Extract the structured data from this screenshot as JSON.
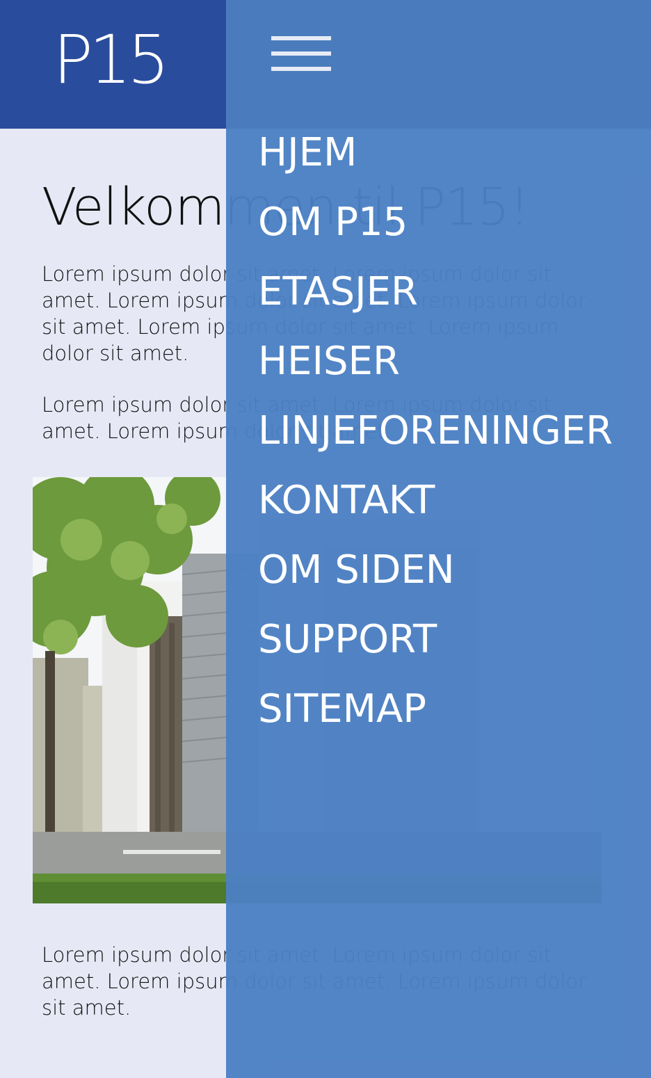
{
  "header": {
    "logo": "P15"
  },
  "main": {
    "title": "Velkommen til P15!",
    "paragraphs": [
      "Lorem ipsum dolor sit amet. Lorem ipsum dolor sit amet. Lorem ipsum dolor sit amet. Lorem ipsum dolor sit amet. Lorem ipsum dolor sit amet. Lorem ipsum dolor sit amet.",
      "Lorem ipsum dolor sit amet. Lorem ipsum dolor sit amet. Lorem ipsum dolor sit amet.",
      "Lorem ipsum dolor sit amet. Lorem ipsum dolor sit amet. Lorem ipsum dolor sit amet. Lorem ipsum dolor sit amet."
    ]
  },
  "menu": {
    "items": [
      "HJEM",
      "OM P15",
      "ETASJER",
      "HEISER",
      "LINJEFORENINGER",
      "KONTAKT",
      "OM SIDEN",
      "SUPPORT",
      "SITEMAP"
    ]
  },
  "icons": {
    "menu_toggle": "hamburger-icon"
  },
  "colors": {
    "header": "#2a4c9c",
    "menu": "#4c80c4",
    "background": "#e6e9f5"
  }
}
